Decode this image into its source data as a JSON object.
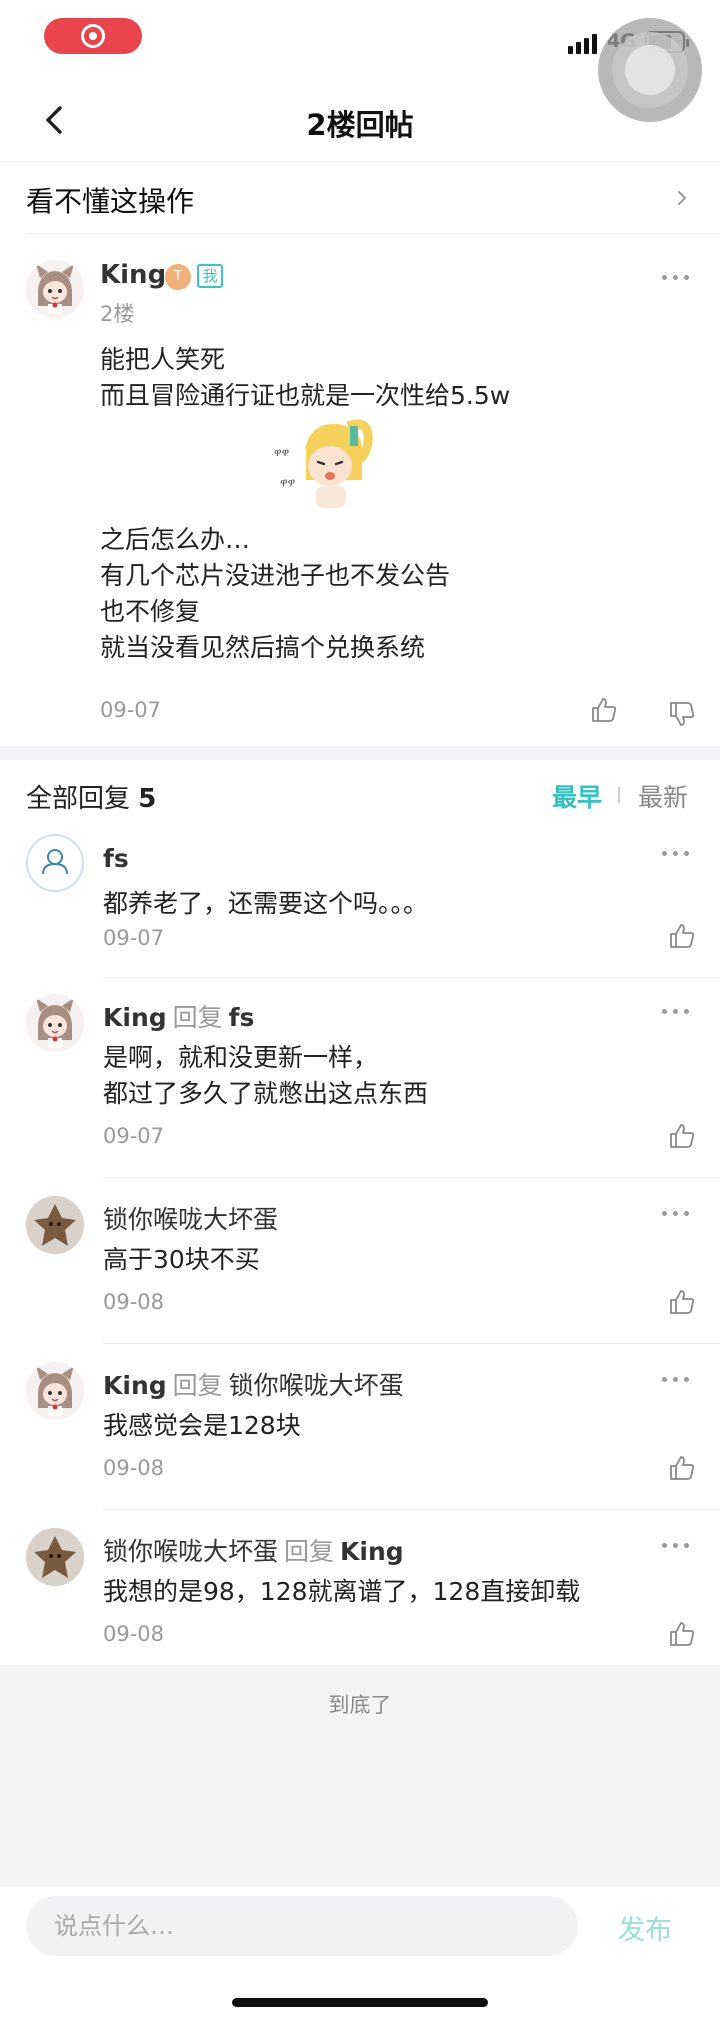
{
  "status_bar": {
    "network": "4G"
  },
  "nav": {
    "title": "2楼回帖"
  },
  "topic": {
    "title": "看不懂这操作"
  },
  "post": {
    "author": "King",
    "level_badge": "T",
    "me_badge": "我",
    "floor": "2楼",
    "lines_before_sticker": [
      "能把人笑死",
      "而且冒险通行证也就是一次性给5.5w"
    ],
    "lines_after_sticker": [
      "之后怎么办…",
      "有几个芯片没进池子也不发公告",
      "也不修复",
      "就当没看见然后搞个兑换系统"
    ],
    "date": "09-07"
  },
  "replies_header": {
    "title": "全部回复",
    "count": "5",
    "sort_earliest": "最早",
    "sort_newest": "最新"
  },
  "replies": [
    {
      "author": "fs",
      "reply_word": "",
      "target": "",
      "lines": [
        "都养老了，还需要这个吗。。。"
      ],
      "date": "09-07"
    },
    {
      "author": "King",
      "reply_word": "回复",
      "target": "fs",
      "lines": [
        "是啊，就和没更新一样，",
        "都过了多久了就憋出这点东西"
      ],
      "date": "09-07"
    },
    {
      "author": "锁你喉咙大坏蛋",
      "reply_word": "",
      "target": "",
      "lines": [
        "高于30块不买"
      ],
      "date": "09-08"
    },
    {
      "author": "King",
      "reply_word": "回复",
      "target": "锁你喉咙大坏蛋",
      "lines": [
        "我感觉会是128块"
      ],
      "date": "09-08"
    },
    {
      "author": "锁你喉咙大坏蛋",
      "reply_word": "回复",
      "target": "King",
      "lines": [
        "我想的是98，128就离谱了，128直接卸载"
      ],
      "date": "09-08"
    }
  ],
  "end_text": "到底了",
  "composer": {
    "placeholder": "说点什么…",
    "publish_label": "发布"
  },
  "colors": {
    "accent": "#36c0c0",
    "record": "#e8444e",
    "publish_disabled": "#9adede"
  }
}
